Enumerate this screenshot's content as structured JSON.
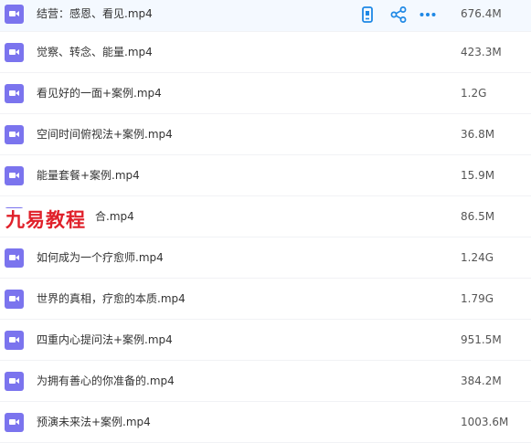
{
  "files": [
    {
      "name": "结营：感恩、看见.mp4",
      "size": "676.4M"
    },
    {
      "name": "觉察、转念、能量.mp4",
      "size": "423.3M"
    },
    {
      "name": "看见好的一面+案例.mp4",
      "size": "1.2G"
    },
    {
      "name": "空间时间俯视法+案例.mp4",
      "size": "36.8M"
    },
    {
      "name": "能量套餐+案例.mp4",
      "size": "15.9M"
    },
    {
      "name": "合.mp4",
      "size": "86.5M"
    },
    {
      "name": "如何成为一个疗愈师.mp4",
      "size": "1.24G"
    },
    {
      "name": "世界的真相，疗愈的本质.mp4",
      "size": "1.79G"
    },
    {
      "name": "四重内心提问法+案例.mp4",
      "size": "951.5M"
    },
    {
      "name": "为拥有善心的你准备的.mp4",
      "size": "384.2M"
    },
    {
      "name": "预演未来法+案例.mp4",
      "size": "1003.6M"
    }
  ],
  "row_actions": {
    "icons": [
      "phone-icon",
      "share-icon",
      "more-icon"
    ],
    "accent": "#1e88e5"
  },
  "watermark": "九易教程",
  "colors": {
    "file_icon": "#7b74ee",
    "hover_row": "#f4f9ff"
  }
}
